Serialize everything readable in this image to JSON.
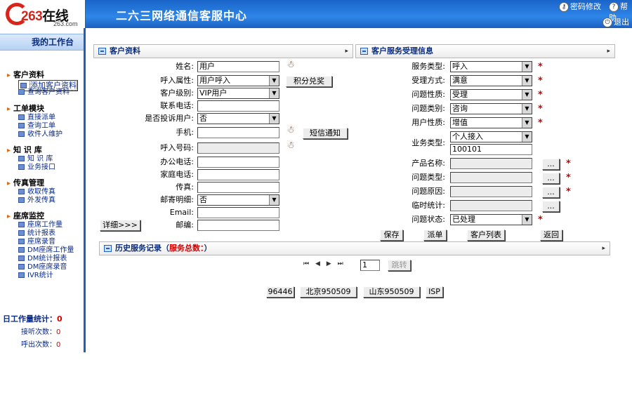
{
  "header": {
    "brand_number": "263",
    "brand_text": "在线",
    "brand_domain": "263.com",
    "site_title": "二六三网络通信客服中心",
    "password_link": "密码修改",
    "help_link": "帮助",
    "exit_link": "退出"
  },
  "sidebar": {
    "title": "我的工作台",
    "groups": [
      {
        "label": "客户资料",
        "items": [
          "添加客户资料",
          "查询客户资料"
        ]
      },
      {
        "label": "工单模块",
        "items": [
          "直接派单",
          "查询工单",
          "收件人维护"
        ]
      },
      {
        "label": "知 识 库",
        "items": [
          "知 识 库",
          "业务接口"
        ]
      },
      {
        "label": "传真管理",
        "items": [
          "收取传真",
          "外发传真"
        ]
      },
      {
        "label": "座席监控",
        "items": [
          "座席工作量",
          "统计报表",
          "座席录音",
          "DM座席工作量",
          "DM统计报表",
          "DM座席录音",
          "IVR统计"
        ]
      }
    ],
    "stats_title": "日工作量统计：",
    "stats_value": "0",
    "listen_label": "接听次数：",
    "listen_value": "0",
    "call_label": "呼出次数：",
    "call_value": "0"
  },
  "customer": {
    "title": "客户资料",
    "name_label": "姓名:",
    "name_value": "用户",
    "call_attr_label": "呼入属性:",
    "call_attr_value": "用户呼入",
    "level_label": "客户级别:",
    "level_value": "VIP用户",
    "phone_label": "联系电话:",
    "complaint_label": "是否投诉用户:",
    "complaint_value": "否",
    "mobile_label": "手机:",
    "call_number_label": "呼入号码:",
    "office_label": "办公电话:",
    "home_label": "家庭电话:",
    "fax_label": "传真:",
    "mail_detail_label": "邮寄明细:",
    "mail_detail_value": "否",
    "email_label": "Email:",
    "zip_label": "邮编:",
    "points_button": "积分兑奖",
    "sms_button": "短信通知",
    "detail_button": "详细>>>"
  },
  "service": {
    "title": "客户服务受理信息",
    "service_type_label": "服务类型:",
    "service_type_value": "呼入",
    "accept_way_label": "受理方式:",
    "accept_way_value": "满意",
    "problem_nature_label": "问题性质:",
    "problem_nature_value": "受理",
    "problem_category_label": "问题类别:",
    "problem_category_value": "咨询",
    "user_nature_label": "用户性质:",
    "user_nature_value": "增值",
    "business_type_label": "业务类型:",
    "business_type_value": "个人接入",
    "business_code_value": "100101",
    "product_label": "产品名称:",
    "problem_type_label": "问题类型:",
    "problem_reason_label": "问题原因:",
    "temp_stat_label": "临时统计:",
    "problem_status_label": "问题状态:",
    "problem_status_value": "已处理",
    "more_button": "...",
    "save_button": "保存",
    "dispatch_button": "派单",
    "customer_list_button": "客户列表",
    "return_button": "返回"
  },
  "history": {
    "title": "历史服务记录（",
    "total_label": "服务总数：",
    "suffix": "）",
    "page_value": "1",
    "jump_button": "跳转"
  },
  "quick_buttons": [
    "96446",
    "北京950509",
    "山东950509",
    "ISP"
  ]
}
